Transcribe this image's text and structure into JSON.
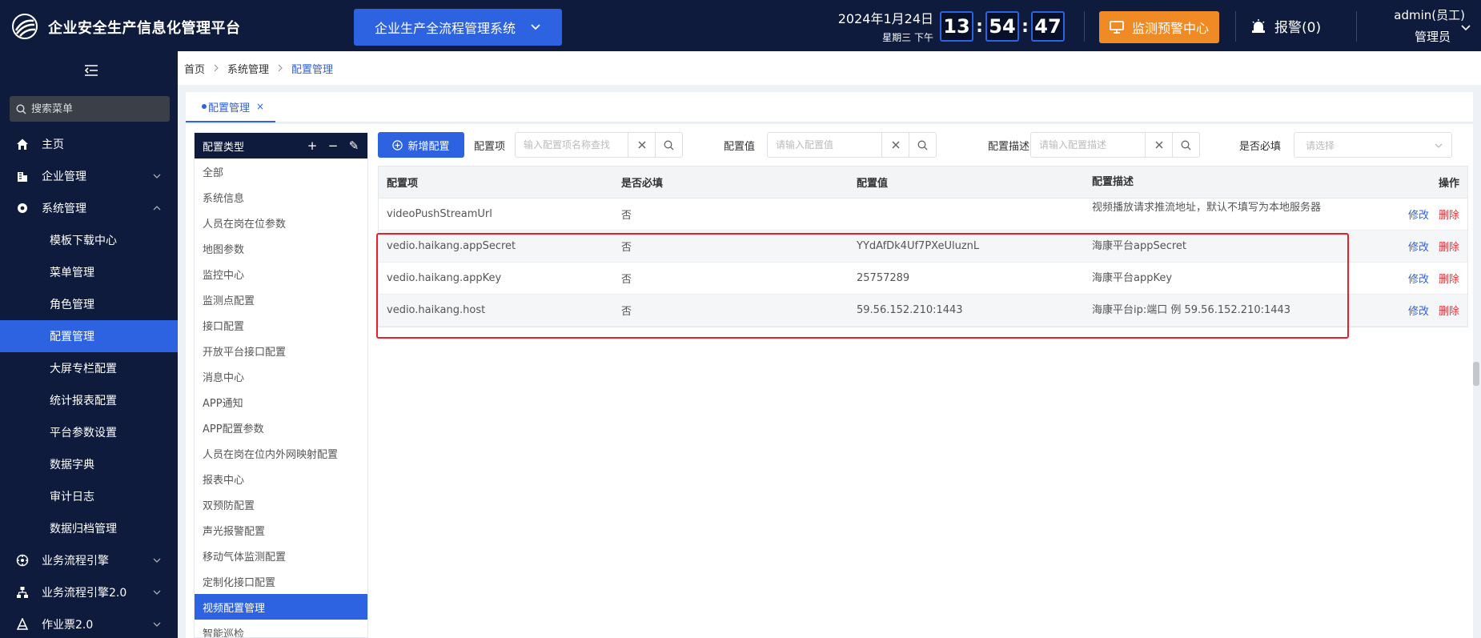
{
  "header": {
    "app_title": "企业安全生产信息化管理平台",
    "system_select": "企业生产全流程管理系统",
    "date": "2024年1月24日",
    "weekday_period": "星期三  下午",
    "clock": {
      "hh": "13",
      "mm": "54",
      "ss": "47",
      "sep": ":"
    },
    "monitor_button": "监测预警中心",
    "alarm_label": "报警(0)",
    "user_name": "admin(员工)",
    "user_role": "管理员",
    "colors": {
      "bg": "#0f1b3c",
      "accent": "#2d62e0",
      "monitor": "#f08a24"
    }
  },
  "sidebar": {
    "search_placeholder": "搜索菜单",
    "items": [
      {
        "label": "主页",
        "icon": "home-icon",
        "level": 1
      },
      {
        "label": "企业管理",
        "icon": "building-icon",
        "level": 1,
        "chevron": "down"
      },
      {
        "label": "系统管理",
        "icon": "gear-icon",
        "level": 1,
        "chevron": "up"
      },
      {
        "label": "模板下载中心",
        "level": 2
      },
      {
        "label": "菜单管理",
        "level": 2
      },
      {
        "label": "角色管理",
        "level": 2
      },
      {
        "label": "配置管理",
        "level": 2,
        "active": true
      },
      {
        "label": "大屏专栏配置",
        "level": 2
      },
      {
        "label": "统计报表配置",
        "level": 2
      },
      {
        "label": "平台参数设置",
        "level": 2
      },
      {
        "label": "数据字典",
        "level": 2
      },
      {
        "label": "审计日志",
        "level": 2
      },
      {
        "label": "数据归档管理",
        "level": 2
      },
      {
        "label": "业务流程引擎",
        "icon": "workflow-icon",
        "level": 1,
        "chevron": "down"
      },
      {
        "label": "业务流程引擎2.0",
        "icon": "workflow2-icon",
        "level": 1,
        "chevron": "down"
      },
      {
        "label": "作业票2.0",
        "icon": "ticket-icon",
        "level": 1,
        "chevron": "down"
      }
    ]
  },
  "breadcrumb": [
    "首页",
    "系统管理",
    "配置管理"
  ],
  "tabs": [
    {
      "label": "配置管理",
      "close": "×"
    }
  ],
  "type_panel": {
    "title": "配置类型",
    "actions": [
      "+",
      "−",
      "✎"
    ],
    "items": [
      "全部",
      "系统信息",
      "人员在岗在位参数",
      "地图参数",
      "监控中心",
      "监测点配置",
      "接口配置",
      "开放平台接口配置",
      "消息中心",
      "APP通知",
      "APP配置参数",
      "人员在岗在位内外网映射配置",
      "报表中心",
      "双预防配置",
      "声光报警配置",
      "移动气体监测配置",
      "定制化接口配置",
      "视频配置管理",
      "智能巡检"
    ],
    "active_index": 17
  },
  "toolbar": {
    "add_button": "新增配置",
    "filters": [
      {
        "label": "配置项",
        "placeholder": "输入配置项名称查找"
      },
      {
        "label": "配置值",
        "placeholder": "请输入配置值"
      },
      {
        "label": "配置描述",
        "placeholder": "请输入配置描述"
      }
    ],
    "required_label": "是否必填",
    "required_placeholder": "请选择"
  },
  "table": {
    "columns": [
      "配置项",
      "是否必填",
      "配置值",
      "配置描述",
      "操作"
    ],
    "edit_label": "修改",
    "delete_label": "删除",
    "rows": [
      {
        "key": "videoPushStreamUrl",
        "required": "否",
        "value": "",
        "desc": "视频播放请求推流地址，默认不填写为本地服务器"
      },
      {
        "key": "vedio.haikang.appSecret",
        "required": "否",
        "value": "YYdAfDk4Uf7PXeUluznL",
        "desc": "海康平台appSecret"
      },
      {
        "key": "vedio.haikang.appKey",
        "required": "否",
        "value": "25757289",
        "desc": "海康平台appKey"
      },
      {
        "key": "vedio.haikang.host",
        "required": "否",
        "value": "59.56.152.210:1443",
        "desc": "海康平台ip:端口 例 59.56.152.210:1443"
      }
    ]
  }
}
